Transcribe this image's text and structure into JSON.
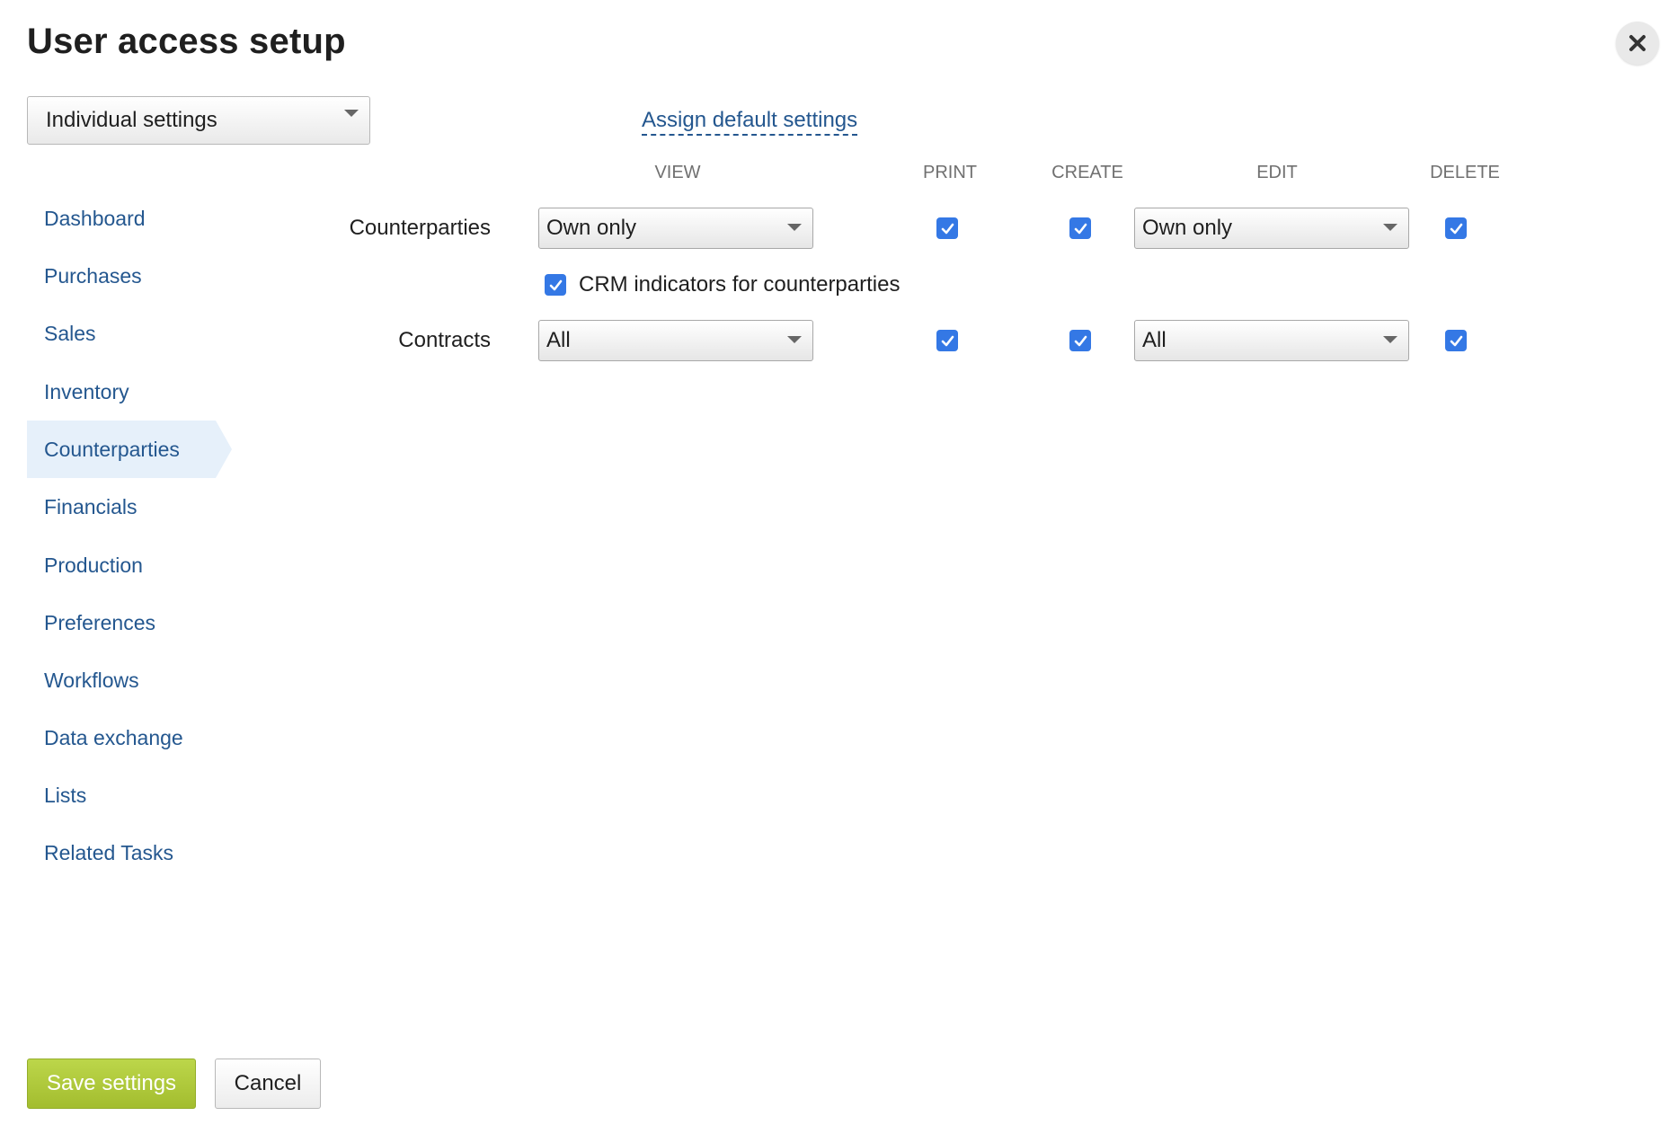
{
  "dialog": {
    "title": "User access setup",
    "close_icon": "close-icon"
  },
  "mode_select": {
    "value": "Individual settings"
  },
  "assign_default_link": "Assign default settings",
  "columns": {
    "view": "VIEW",
    "print": "PRINT",
    "create": "CREATE",
    "edit": "EDIT",
    "delete": "DELETE"
  },
  "sidebar": {
    "active": "Counterparties",
    "items": [
      {
        "label": "Dashboard"
      },
      {
        "label": "Purchases"
      },
      {
        "label": "Sales"
      },
      {
        "label": "Inventory"
      },
      {
        "label": "Counterparties"
      },
      {
        "label": "Financials"
      },
      {
        "label": "Production"
      },
      {
        "label": "Preferences"
      },
      {
        "label": "Workflows"
      },
      {
        "label": "Data exchange"
      },
      {
        "label": "Lists"
      },
      {
        "label": "Related Tasks"
      }
    ]
  },
  "rows": [
    {
      "label": "Counterparties",
      "view": "Own only",
      "print": true,
      "create": true,
      "edit": "Own only",
      "delete": true
    },
    {
      "label": "Contracts",
      "view": "All",
      "print": true,
      "create": true,
      "edit": "All",
      "delete": true
    }
  ],
  "crm_indicators": {
    "label": "CRM indicators for counterparties",
    "checked": true
  },
  "footer": {
    "save_label": "Save settings",
    "cancel_label": "Cancel"
  },
  "colors": {
    "link": "#24578f",
    "checkbox": "#3478e5",
    "save_button": "#aec83a",
    "active_nav_bg": "#e6f0fa"
  }
}
